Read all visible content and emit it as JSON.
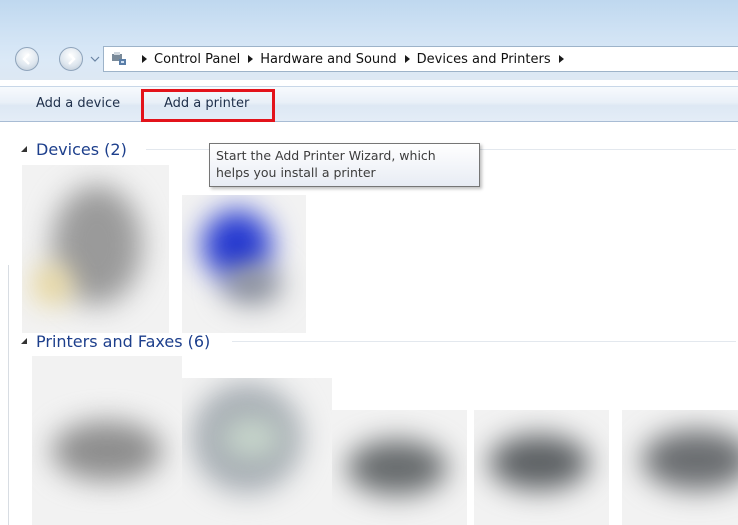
{
  "breadcrumb": {
    "items": [
      "Control Panel",
      "Hardware and Sound",
      "Devices and Printers"
    ]
  },
  "toolbar": {
    "add_device_label": "Add a device",
    "add_printer_label": "Add a printer"
  },
  "tooltip": {
    "line1": "Start the Add Printer Wizard, which",
    "line2": "helps you install a printer"
  },
  "groups": {
    "devices": {
      "title": "Devices (2)"
    },
    "printers": {
      "title": "Printers and Faxes (6)"
    }
  },
  "colors": {
    "highlight_border": "#e3131b",
    "group_title": "#1d3f8c"
  },
  "icons": [
    "back-icon",
    "forward-icon",
    "history-dropdown-icon",
    "devices-printers-icon",
    "breadcrumb-arrow-icon",
    "collapse-triangle-icon"
  ]
}
